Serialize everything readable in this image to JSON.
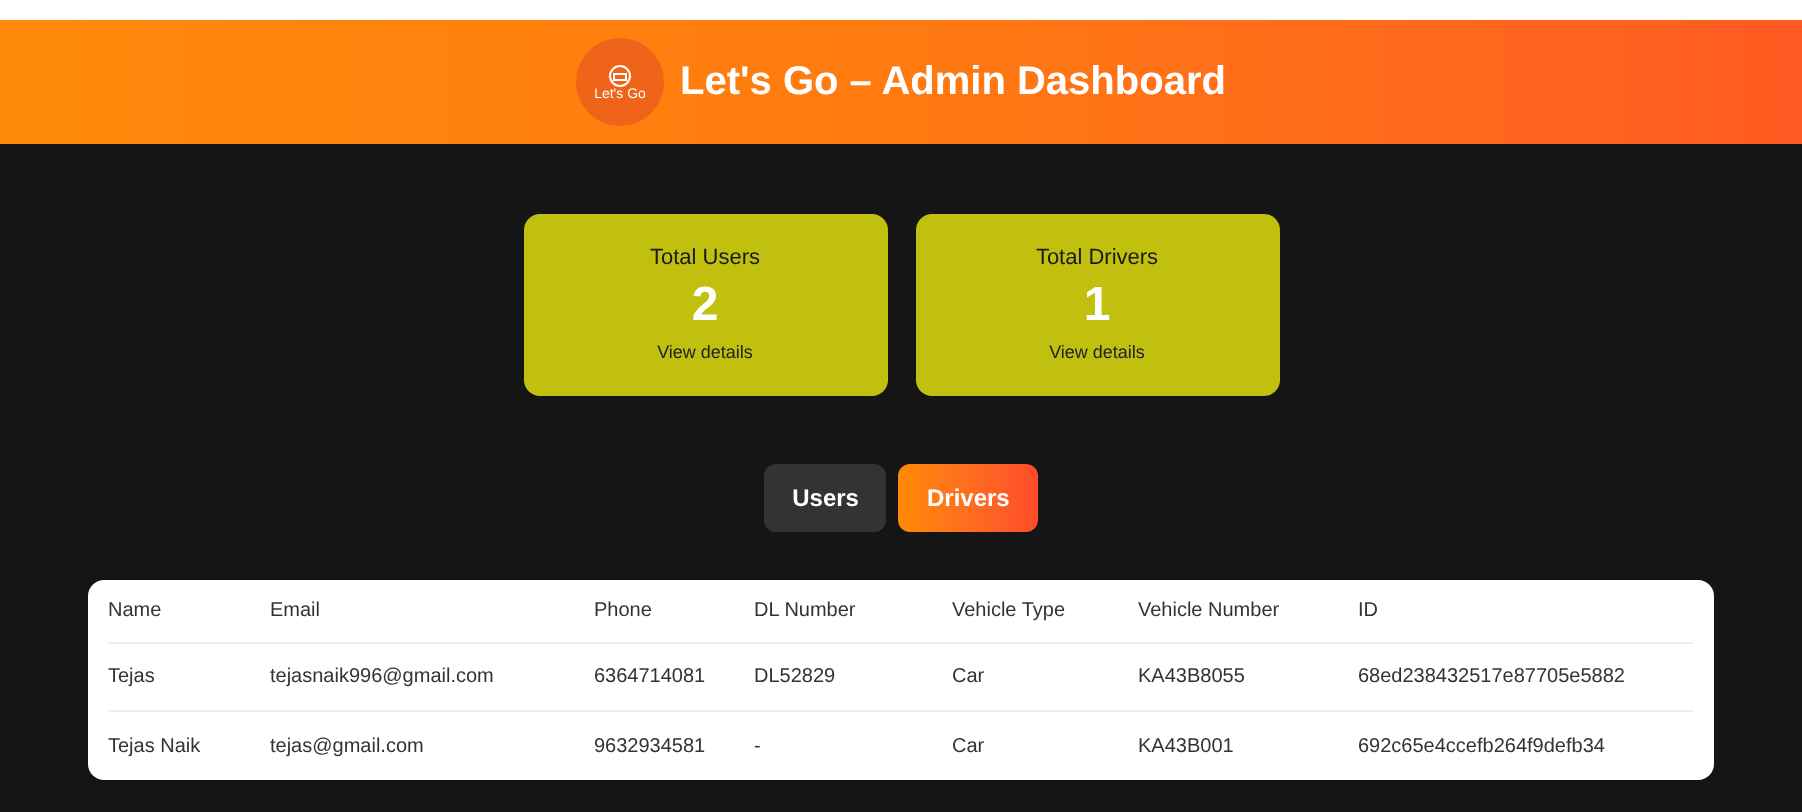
{
  "header": {
    "logo_text": "Let's Go",
    "title": "Let's Go – Admin Dashboard"
  },
  "stats": [
    {
      "label": "Total Users",
      "value": "2",
      "link": "View details"
    },
    {
      "label": "Total Drivers",
      "value": "1",
      "link": "View details"
    }
  ],
  "tabs": [
    {
      "label": "Users",
      "selected": false
    },
    {
      "label": "Drivers",
      "selected": true
    }
  ],
  "table": {
    "columns": [
      "Name",
      "Email",
      "Phone",
      "DL Number",
      "Vehicle Type",
      "Vehicle Number",
      "ID"
    ],
    "rows": [
      [
        "Tejas",
        "tejasnaik996@gmail.com",
        "6364714081",
        "DL52829",
        "Car",
        "KA43B8055",
        "68ed238432517e87705e5882"
      ],
      [
        "Tejas Naik",
        "tejas@gmail.com",
        "9632934581",
        "-",
        "Car",
        "KA43B001",
        "692c65e4ccefb264f9defb34"
      ]
    ]
  }
}
